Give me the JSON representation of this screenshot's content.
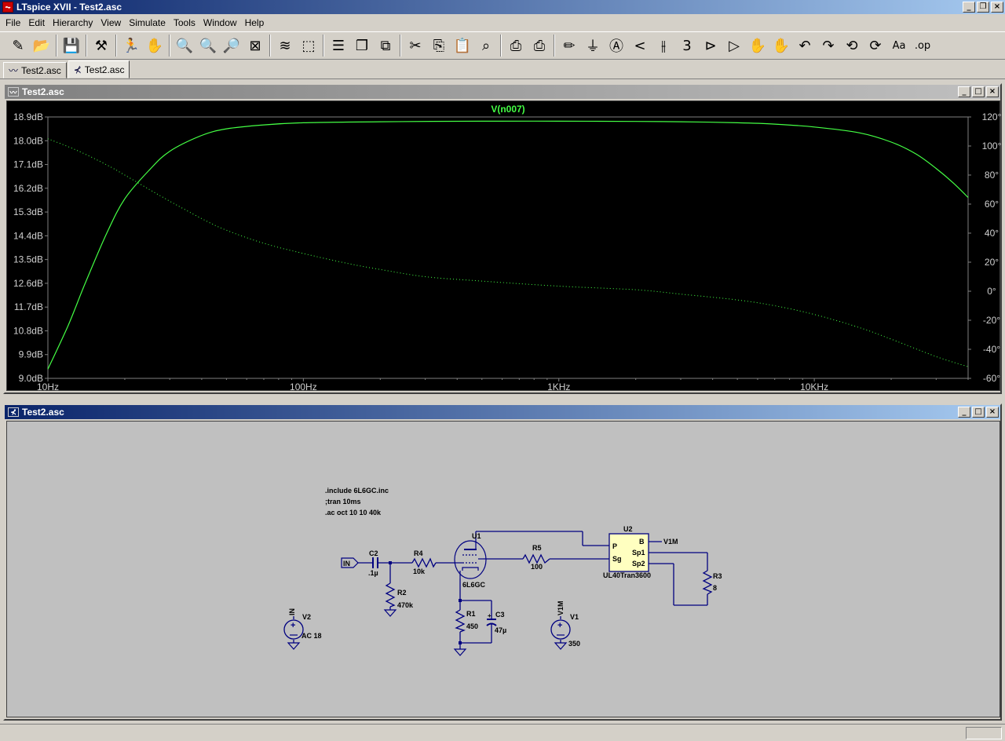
{
  "app": {
    "title": "LTspice XVII - Test2.asc",
    "icon": "ltspice-icon"
  },
  "menu": [
    "File",
    "Edit",
    "Hierarchy",
    "View",
    "Simulate",
    "Tools",
    "Window",
    "Help"
  ],
  "toolbar": [
    {
      "name": "new-schematic-icon",
      "glyph": "✎"
    },
    {
      "name": "open-folder-icon",
      "glyph": "📂"
    },
    {
      "sep": true
    },
    {
      "name": "save-icon",
      "glyph": "💾"
    },
    {
      "sep": true
    },
    {
      "name": "control-panel-icon",
      "glyph": "⚒"
    },
    {
      "sep": true
    },
    {
      "name": "run-icon",
      "glyph": "🏃"
    },
    {
      "name": "halt-icon",
      "glyph": "✋"
    },
    {
      "sep": true
    },
    {
      "name": "zoom-in-icon",
      "glyph": "🔍"
    },
    {
      "name": "pan-icon",
      "glyph": "🔍"
    },
    {
      "name": "zoom-out-icon",
      "glyph": "🔎"
    },
    {
      "name": "zoom-fit-icon",
      "glyph": "⊠"
    },
    {
      "sep": true
    },
    {
      "name": "autorange-icon",
      "glyph": "≋"
    },
    {
      "name": "ruler-icon",
      "glyph": "⬚"
    },
    {
      "sep": true
    },
    {
      "name": "tile-horizontal-icon",
      "glyph": "☰"
    },
    {
      "name": "cascade-icon",
      "glyph": "❐"
    },
    {
      "name": "tile-vertical-icon",
      "glyph": "⧉"
    },
    {
      "sep": true
    },
    {
      "name": "cut-icon",
      "glyph": "✂"
    },
    {
      "name": "copy-icon",
      "glyph": "⎘"
    },
    {
      "name": "paste-icon",
      "glyph": "📋"
    },
    {
      "name": "find-icon",
      "glyph": "⌕"
    },
    {
      "sep": true
    },
    {
      "name": "print-icon",
      "glyph": "⎙"
    },
    {
      "name": "print-setup-icon",
      "glyph": "⎙"
    },
    {
      "sep": true
    },
    {
      "name": "draw-wire-icon",
      "glyph": "✏"
    },
    {
      "name": "ground-icon",
      "glyph": "⏚"
    },
    {
      "name": "label-net-icon",
      "glyph": "Ⓐ"
    },
    {
      "name": "resistor-icon",
      "glyph": "<"
    },
    {
      "name": "capacitor-icon",
      "glyph": "⫲"
    },
    {
      "name": "inductor-icon",
      "glyph": "3"
    },
    {
      "name": "diode-icon",
      "glyph": "⊳"
    },
    {
      "name": "component-icon",
      "glyph": "▷"
    },
    {
      "name": "move-icon",
      "glyph": "✋"
    },
    {
      "name": "drag-icon",
      "glyph": "✋"
    },
    {
      "name": "undo-icon",
      "glyph": "↶"
    },
    {
      "name": "redo-icon",
      "glyph": "↷"
    },
    {
      "name": "rotate-icon",
      "glyph": "⟲"
    },
    {
      "name": "mirror-icon",
      "glyph": "⟳"
    },
    {
      "name": "text-icon",
      "glyph": "Aa"
    },
    {
      "name": "spice-directive-icon",
      "glyph": ".op"
    }
  ],
  "tabs": [
    {
      "label": "Test2.asc",
      "icon": "waveform-icon",
      "glyph": "〰",
      "active": false
    },
    {
      "label": "Test2.asc",
      "icon": "schematic-icon",
      "glyph": "⊀",
      "active": true
    }
  ],
  "plot_window": {
    "title": "Test2.asc"
  },
  "schematic_window": {
    "title": "Test2.asc"
  },
  "colors": {
    "trace": "#44ff44",
    "plot_bg": "#000000",
    "wire": "#000080",
    "component": "#000080",
    "sch_bg": "#c0c0c0"
  },
  "chart_data": {
    "type": "line",
    "title": "V(n007)",
    "xscale": "log",
    "xlim": [
      10,
      40000
    ],
    "xticks": [
      {
        "value": 10,
        "label": "10Hz"
      },
      {
        "value": 100,
        "label": "100Hz"
      },
      {
        "value": 1000,
        "label": "1KHz"
      },
      {
        "value": 10000,
        "label": "10KHz"
      }
    ],
    "ylim_left": [
      9.0,
      18.9
    ],
    "yticks_left": [
      "18.9dB",
      "18.0dB",
      "17.1dB",
      "16.2dB",
      "15.3dB",
      "14.4dB",
      "13.5dB",
      "12.6dB",
      "11.7dB",
      "10.8dB",
      "9.9dB",
      "9.0dB"
    ],
    "ylim_right": [
      -60,
      120
    ],
    "yticks_right": [
      "120°",
      "100°",
      "80°",
      "60°",
      "40°",
      "20°",
      "0°",
      "-20°",
      "-40°",
      "-60°"
    ],
    "series": [
      {
        "name": "magnitude",
        "style": "solid",
        "axis": "left",
        "points": [
          [
            10,
            9.35
          ],
          [
            12,
            11.0
          ],
          [
            14,
            12.6
          ],
          [
            17,
            14.5
          ],
          [
            20,
            15.8
          ],
          [
            25,
            16.9
          ],
          [
            30,
            17.6
          ],
          [
            40,
            18.2
          ],
          [
            50,
            18.45
          ],
          [
            70,
            18.6
          ],
          [
            100,
            18.68
          ],
          [
            200,
            18.72
          ],
          [
            500,
            18.74
          ],
          [
            1000,
            18.74
          ],
          [
            2000,
            18.73
          ],
          [
            3000,
            18.72
          ],
          [
            5000,
            18.68
          ],
          [
            7000,
            18.63
          ],
          [
            10000,
            18.52
          ],
          [
            15000,
            18.3
          ],
          [
            20000,
            17.95
          ],
          [
            25000,
            17.5
          ],
          [
            30000,
            16.95
          ],
          [
            35000,
            16.4
          ],
          [
            40000,
            15.85
          ]
        ]
      },
      {
        "name": "phase",
        "style": "dotted",
        "axis": "right",
        "points": [
          [
            10,
            105
          ],
          [
            13,
            97
          ],
          [
            17,
            87
          ],
          [
            20,
            80
          ],
          [
            25,
            70
          ],
          [
            30,
            62
          ],
          [
            40,
            50
          ],
          [
            50,
            42
          ],
          [
            70,
            33
          ],
          [
            100,
            26
          ],
          [
            150,
            19
          ],
          [
            200,
            15
          ],
          [
            300,
            10
          ],
          [
            500,
            7
          ],
          [
            1000,
            3.5
          ],
          [
            2000,
            1
          ],
          [
            3000,
            -2
          ],
          [
            5000,
            -6
          ],
          [
            7000,
            -10
          ],
          [
            10000,
            -16
          ],
          [
            15000,
            -25
          ],
          [
            20000,
            -33
          ],
          [
            30000,
            -45
          ],
          [
            40000,
            -52
          ]
        ]
      }
    ]
  },
  "schematic": {
    "directives": [
      ".include 6L6GC.inc",
      ";tran 10ms",
      ".ac oct 10 10 40k"
    ],
    "in_label": "IN",
    "c2": {
      "ref": "C2",
      "value": ".1µ"
    },
    "r4": {
      "ref": "R4",
      "value": "10k"
    },
    "r2": {
      "ref": "R2",
      "value": "470k"
    },
    "u1": {
      "ref": "U1",
      "value": "6L6GC"
    },
    "r5": {
      "ref": "R5",
      "value": "100"
    },
    "r1": {
      "ref": "R1",
      "value": "450"
    },
    "c3": {
      "ref": "C3",
      "value": "47µ"
    },
    "u2": {
      "ref": "U2",
      "value": "UL40Tran3600",
      "pin_p": "P",
      "pin_sg": "Sg",
      "pin_b": "B",
      "pin_sp1": "Sp1",
      "pin_sp2": "Sp2"
    },
    "v1m_label": "V1M",
    "r3": {
      "ref": "R3",
      "value": "8"
    },
    "v2": {
      "ref": "V2",
      "value": "AC 18",
      "net": "IN"
    },
    "v1": {
      "ref": "V1",
      "value": "350",
      "net": "V1M"
    }
  }
}
